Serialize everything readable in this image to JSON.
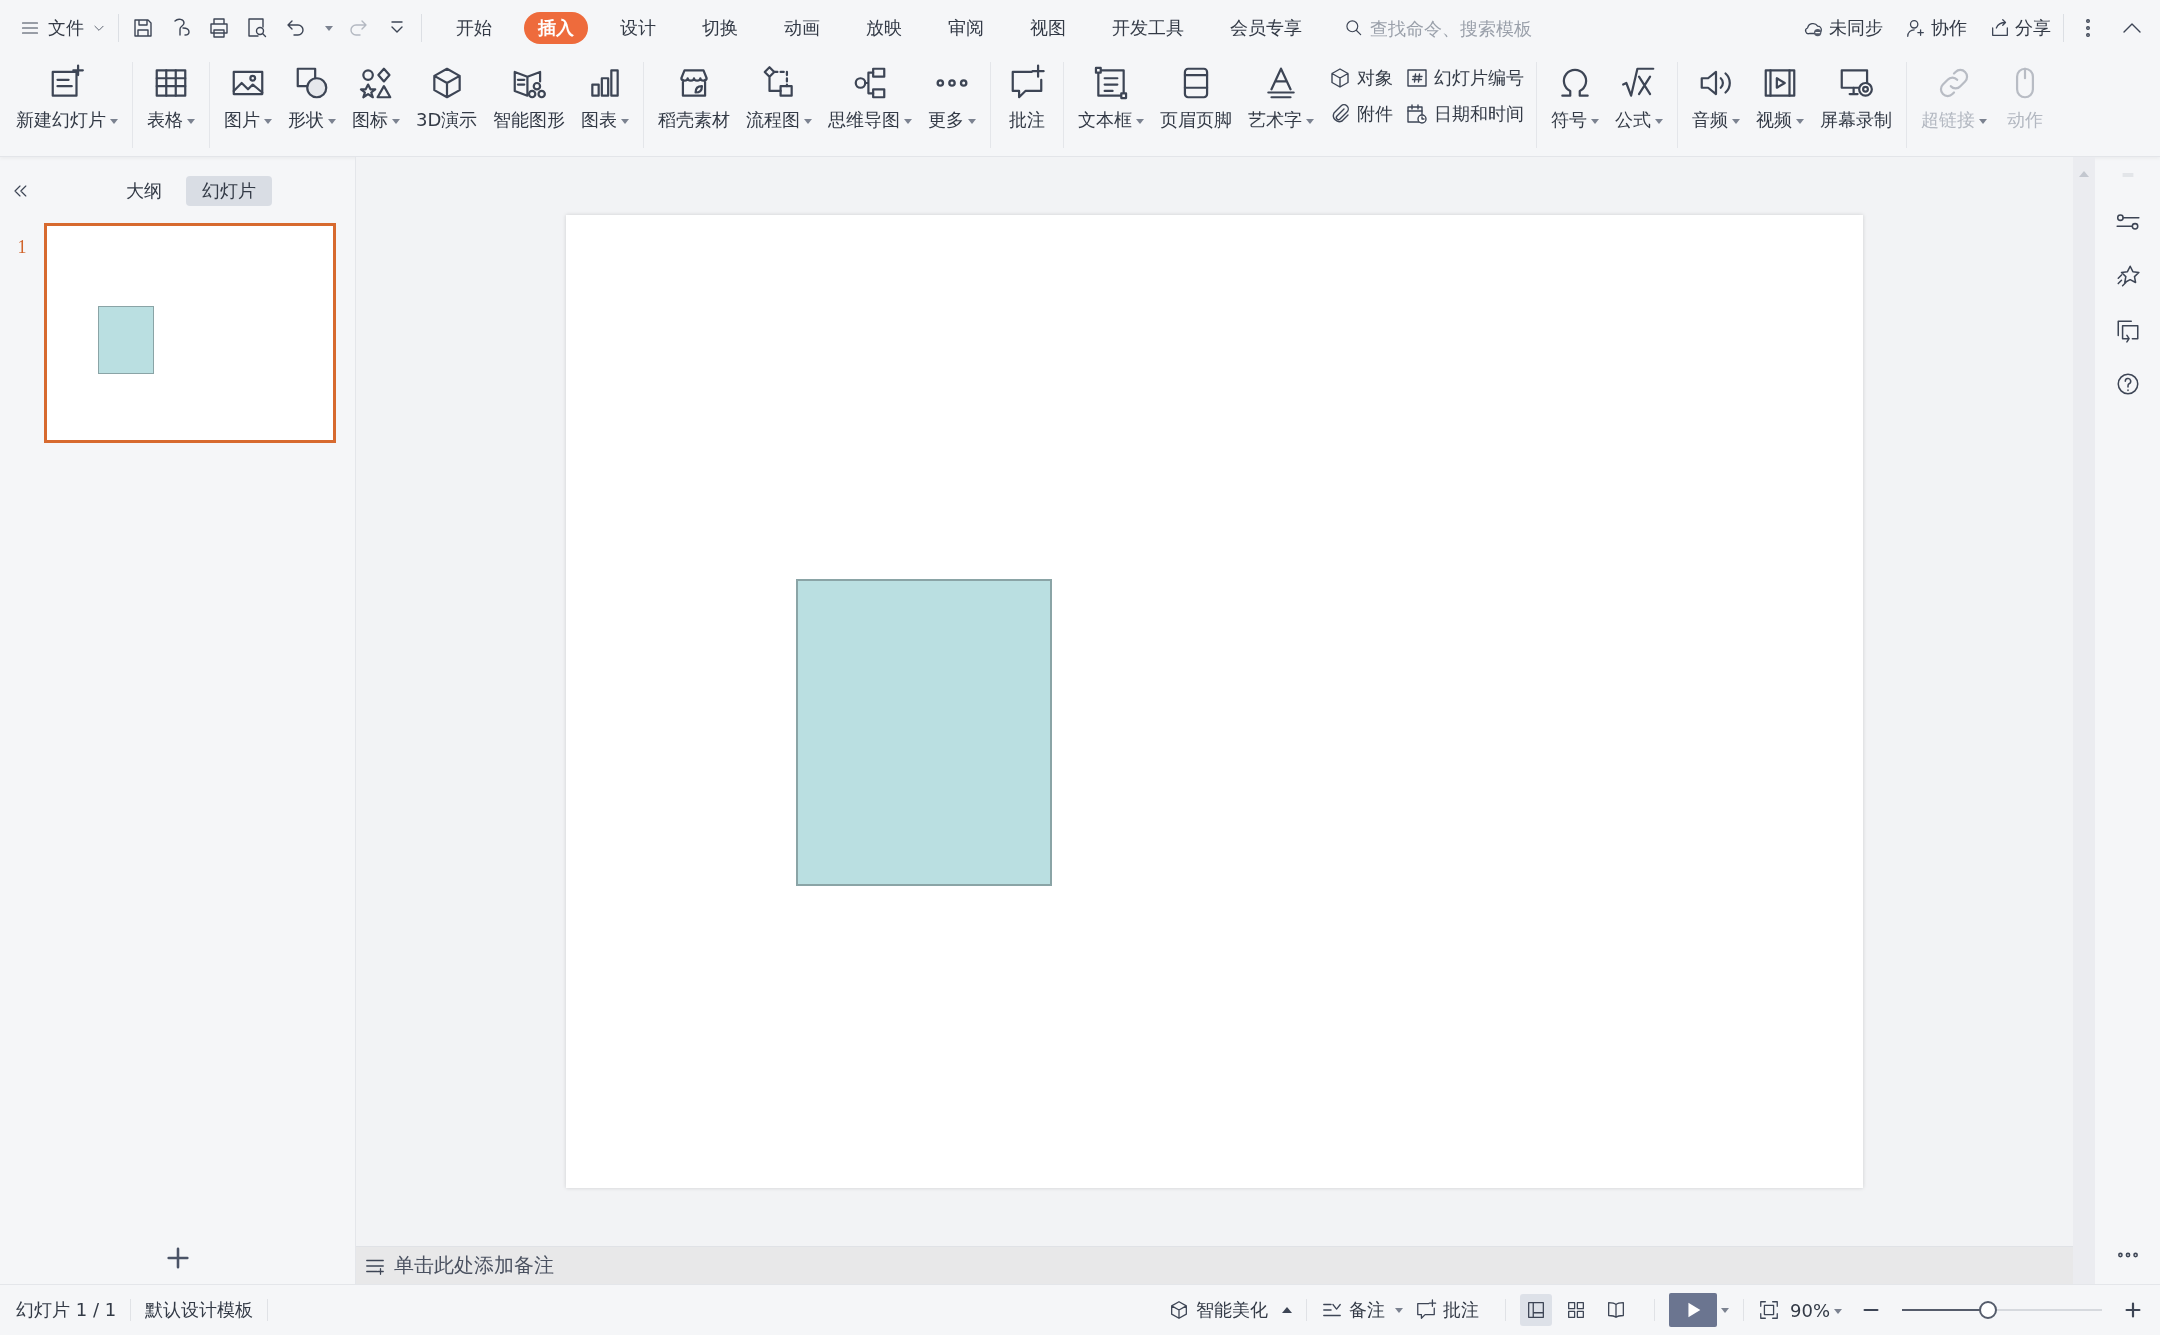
{
  "menu": {
    "label": "文件"
  },
  "tabs": [
    {
      "label": "开始",
      "selected": false
    },
    {
      "label": "插入",
      "selected": true
    },
    {
      "label": "设计",
      "selected": false
    },
    {
      "label": "切换",
      "selected": false
    },
    {
      "label": "动画",
      "selected": false
    },
    {
      "label": "放映",
      "selected": false
    },
    {
      "label": "审阅",
      "selected": false
    },
    {
      "label": "视图",
      "selected": false
    },
    {
      "label": "开发工具",
      "selected": false
    },
    {
      "label": "会员专享",
      "selected": false
    }
  ],
  "search": {
    "placeholder": "查找命令、搜索模板"
  },
  "account_actions": [
    "未同步",
    "协作",
    "分享"
  ],
  "ribbon": {
    "groups": [
      [
        {
          "label": "新建幻灯片",
          "kind": "large",
          "dropdown": true,
          "disabled": false
        }
      ],
      [
        {
          "label": "表格",
          "kind": "large",
          "dropdown": true,
          "disabled": false
        }
      ],
      [
        {
          "label": "图片",
          "kind": "large",
          "dropdown": true,
          "disabled": false
        },
        {
          "label": "形状",
          "kind": "large",
          "dropdown": true,
          "disabled": false
        },
        {
          "label": "图标",
          "kind": "large",
          "dropdown": true,
          "disabled": false
        },
        {
          "label": "3D演示",
          "kind": "large",
          "dropdown": false,
          "disabled": false
        },
        {
          "label": "智能图形",
          "kind": "large",
          "dropdown": false,
          "disabled": false
        },
        {
          "label": "图表",
          "kind": "large",
          "dropdown": true,
          "disabled": false
        }
      ],
      [
        {
          "label": "稻壳素材",
          "kind": "large",
          "dropdown": false,
          "disabled": false
        },
        {
          "label": "流程图",
          "kind": "large",
          "dropdown": true,
          "disabled": false
        },
        {
          "label": "思维导图",
          "kind": "large",
          "dropdown": true,
          "disabled": false
        },
        {
          "label": "更多",
          "kind": "large",
          "dropdown": true,
          "disabled": false
        }
      ],
      [
        {
          "label": "批注",
          "kind": "large",
          "dropdown": false,
          "disabled": false
        }
      ],
      [
        {
          "label": "文本框",
          "kind": "large",
          "dropdown": true,
          "disabled": false
        },
        {
          "label": "页眉页脚",
          "kind": "large",
          "dropdown": false,
          "disabled": false
        },
        {
          "label": "艺术字",
          "kind": "large",
          "dropdown": true,
          "disabled": false
        },
        {
          "label": "对象",
          "kind": "small",
          "dropdown": false,
          "disabled": false
        },
        {
          "label": "附件",
          "kind": "small",
          "dropdown": false,
          "disabled": false
        },
        {
          "label": "幻灯片编号",
          "kind": "small",
          "dropdown": false,
          "disabled": false
        },
        {
          "label": "日期和时间",
          "kind": "small",
          "dropdown": false,
          "disabled": false
        }
      ],
      [
        {
          "label": "符号",
          "kind": "large",
          "dropdown": true,
          "disabled": false
        },
        {
          "label": "公式",
          "kind": "large",
          "dropdown": true,
          "disabled": false
        }
      ],
      [
        {
          "label": "音频",
          "kind": "large",
          "dropdown": true,
          "disabled": false
        },
        {
          "label": "视频",
          "kind": "large",
          "dropdown": true,
          "disabled": false
        },
        {
          "label": "屏幕录制",
          "kind": "large",
          "dropdown": false,
          "disabled": false
        }
      ],
      [
        {
          "label": "超链接",
          "kind": "large",
          "dropdown": true,
          "disabled": true
        },
        {
          "label": "动作",
          "kind": "large",
          "dropdown": false,
          "disabled": true
        }
      ]
    ]
  },
  "side_panel": {
    "tabs": [
      {
        "label": "大纲",
        "selected": false
      },
      {
        "label": "幻灯片",
        "selected": true
      }
    ],
    "slides": [
      {
        "number": "1",
        "selected": true
      }
    ]
  },
  "notes": {
    "placeholder": "单击此处添加备注"
  },
  "status_bar": {
    "slide_info": "幻灯片 1 / 1",
    "template": "默认设计模板",
    "beautify": "智能美化",
    "notes": "备注",
    "comments": "批注",
    "views": [
      {
        "selected": true
      },
      {
        "selected": false
      },
      {
        "selected": false
      }
    ],
    "zoom": "90%",
    "zoom_slider": {
      "level": 0.43
    }
  }
}
